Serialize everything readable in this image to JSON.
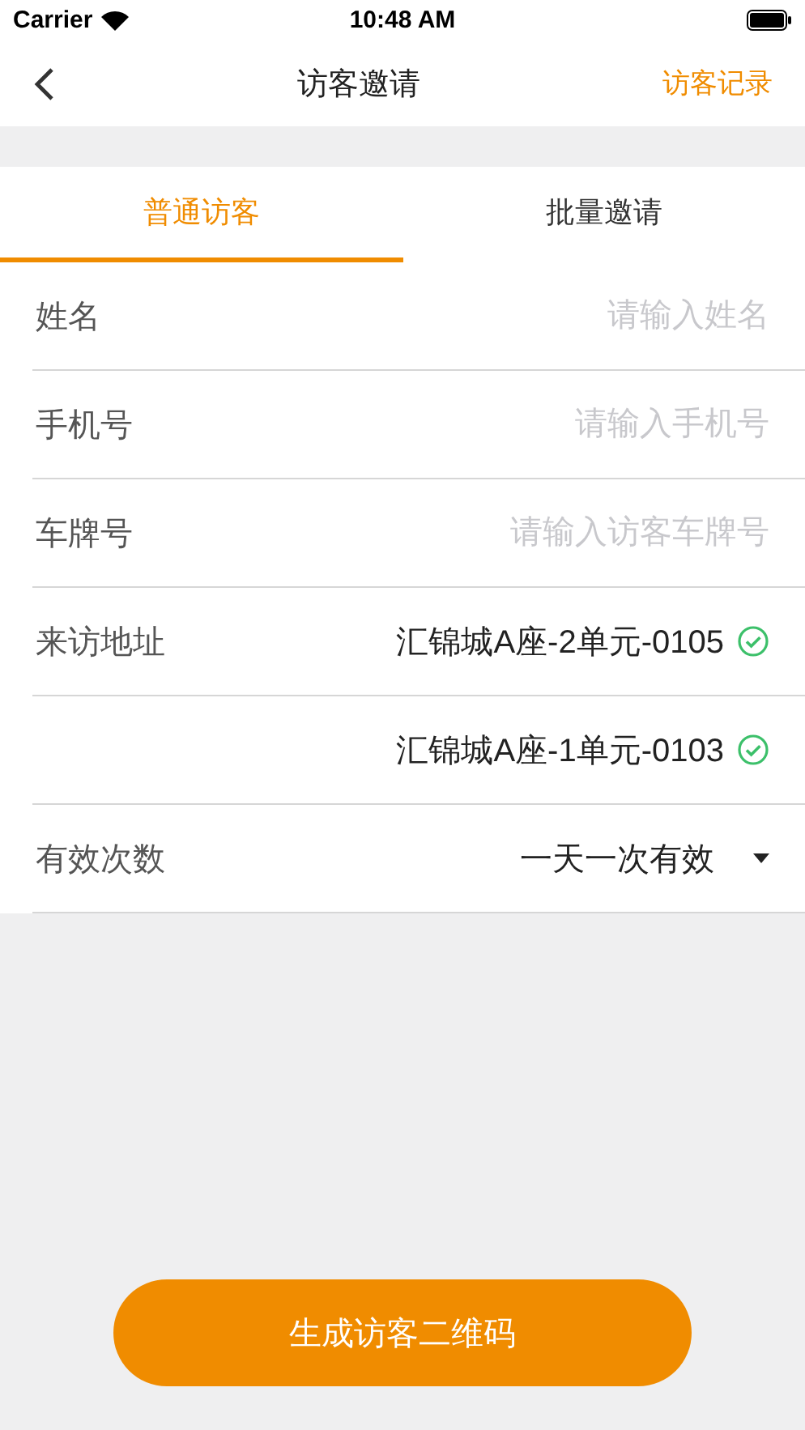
{
  "status_bar": {
    "carrier": "Carrier",
    "time": "10:48 AM"
  },
  "nav": {
    "title": "访客邀请",
    "action": "访客记录"
  },
  "tabs": [
    {
      "label": "普通访客",
      "selected": true
    },
    {
      "label": "批量邀请",
      "selected": false
    }
  ],
  "form": [
    {
      "kind": "input",
      "label": "姓名",
      "placeholder": "请输入姓名"
    },
    {
      "kind": "input",
      "label": "手机号",
      "placeholder": "请输入手机号"
    },
    {
      "kind": "input",
      "label": "车牌号",
      "placeholder": "请输入访客车牌号"
    },
    {
      "kind": "address",
      "label": "来访地址",
      "value": "汇锦城A座-2单元-0105",
      "checked": true
    },
    {
      "kind": "address",
      "value": "汇锦城A座-1单元-0103",
      "checked": true
    },
    {
      "kind": "select",
      "label": "有效次数",
      "value": "一天一次有效"
    }
  ],
  "submit": "生成访客二维码"
}
